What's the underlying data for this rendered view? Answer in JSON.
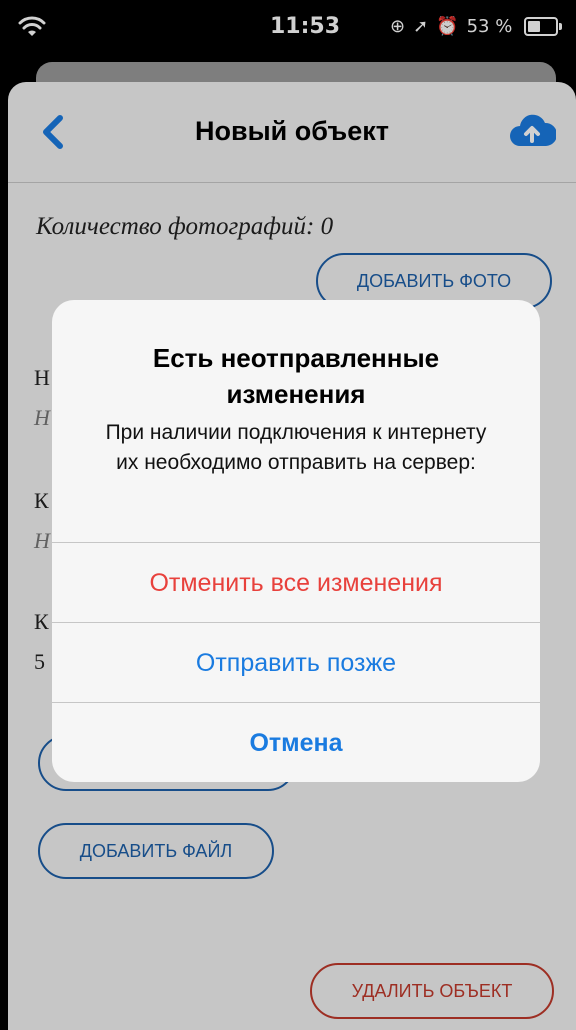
{
  "status_bar": {
    "time": "11:53",
    "battery_percent": "53 %",
    "battery_level": 0.53,
    "icons": [
      "wifi-icon",
      "rotation-lock-icon",
      "location-arrow-icon",
      "alarm-icon",
      "battery-icon"
    ]
  },
  "nav": {
    "title": "Новый объект",
    "back_icon": "chevron-left-icon",
    "upload_icon": "cloud-upload-icon"
  },
  "content": {
    "photo_count_label": "Количество фотографий: 0",
    "add_photo_label": "ДОБАВИТЬ ФОТО",
    "add_file_label": "ДОБАВИТЬ ФАЙЛ",
    "delete_object_label": "УДАЛИТЬ ОБЪЕКТ",
    "partial_labels": [
      "Н",
      "Н",
      "К",
      "Н",
      "К",
      "5"
    ]
  },
  "alert": {
    "title": "Есть неотправленные изменения",
    "message": "При наличии подключения к интернету их необходимо отправить на сервер:",
    "actions": {
      "discard": "Отменить все изменения",
      "later": "Отправить позже",
      "cancel": "Отмена"
    }
  },
  "colors": {
    "accent": "#1a7be0",
    "destructive": "#e8413c",
    "outline": "#1d5fa8"
  }
}
